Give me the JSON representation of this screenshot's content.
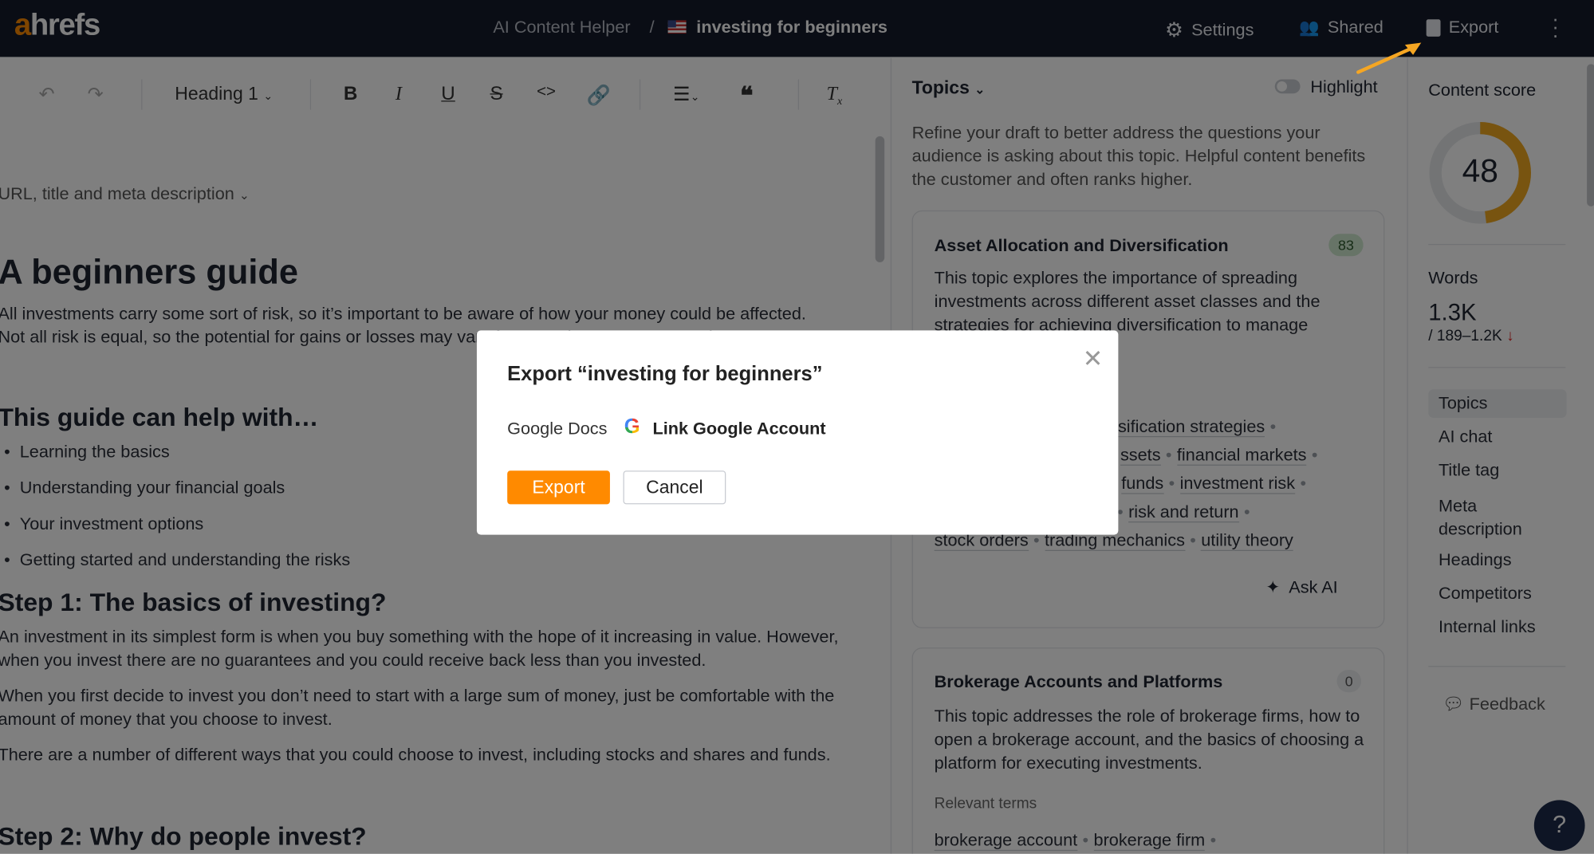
{
  "topbar": {
    "logo": "ahrefs",
    "breadcrumb_root": "AI Content Helper",
    "breadcrumb_sep": "/",
    "document_title": "investing for beginners",
    "settings_label": "Settings",
    "shared_label": "Shared",
    "export_label": "Export"
  },
  "toolbar": {
    "heading_select": "Heading 1"
  },
  "editor": {
    "meta_toggle": "URL, title and meta description",
    "h1": "A beginners guide",
    "intro": "All investments carry some sort of risk, so it’s important to be aware of how your money could be affected. Not all risk is equal, so the potential for gains or losses may vary from one investment to another.",
    "h2_help": "This guide can help with…",
    "bullets": [
      "Learning the basics",
      "Understanding your financial goals",
      "Your investment options",
      "Getting started and understanding the risks"
    ],
    "h2_step1": "Step 1: The basics of investing?",
    "p1": "An investment in its simplest form is when you buy something with the hope of it increasing in value. However, when you invest there are no guarantees and you could receive back less than you invested.",
    "p2": "When you first decide to invest you don’t need to start with a large sum of money, just be comfortable with the amount of money that you choose to invest.",
    "p3": "There are a number of different ways that you could choose to invest, including stocks and shares and funds.",
    "h2_step2": "Step 2: Why do people invest?"
  },
  "topics": {
    "header": "Topics",
    "highlight_label": "Highlight",
    "highlight_on": false,
    "description": "Refine your draft to better address the questions your audience is asking about this topic. Helpful content benefits the customer and often ranks higher.",
    "cards": [
      {
        "title": "Asset Allocation and Diversification",
        "score": "83",
        "text": "This topic explores the importance of spreading investments across different asset classes and the strategies for achieving diversification to manage",
        "terms_lines": [
          [
            "rsification strategies"
          ],
          [
            "ssets",
            "financial markets"
          ],
          [
            "funds",
            "investment risk"
          ],
          [
            "risk and return"
          ],
          [
            "stock orders",
            "trading mechanics",
            "utility theory"
          ]
        ],
        "ask_ai": "Ask AI"
      },
      {
        "title": "Brokerage Accounts and Platforms",
        "score": "0",
        "text": "This topic addresses the role of brokerage firms, how to open a brokerage account, and the basics of choosing a platform for executing investments.",
        "relevant_label": "Relevant terms",
        "terms": [
          "brokerage account",
          "brokerage firm"
        ]
      }
    ]
  },
  "sidebar": {
    "content_score_label": "Content score",
    "content_score": "48",
    "content_score_value": 48,
    "words_label": "Words",
    "words_value": "1.3K",
    "words_range": "/ 189–1.2K",
    "nav": [
      "Topics",
      "AI chat",
      "Title tag",
      "Meta description",
      "Headings",
      "Competitors",
      "Internal links"
    ],
    "feedback": "Feedback",
    "help": "?"
  },
  "modal": {
    "title": "Export “investing for beginners”",
    "destination": "Google Docs",
    "link_account": "Link Google Account",
    "export_button": "Export",
    "cancel_button": "Cancel"
  },
  "colors": {
    "brand": "#ff8a00",
    "score_ring": "#f0a820",
    "topbar": "#151b2b"
  }
}
